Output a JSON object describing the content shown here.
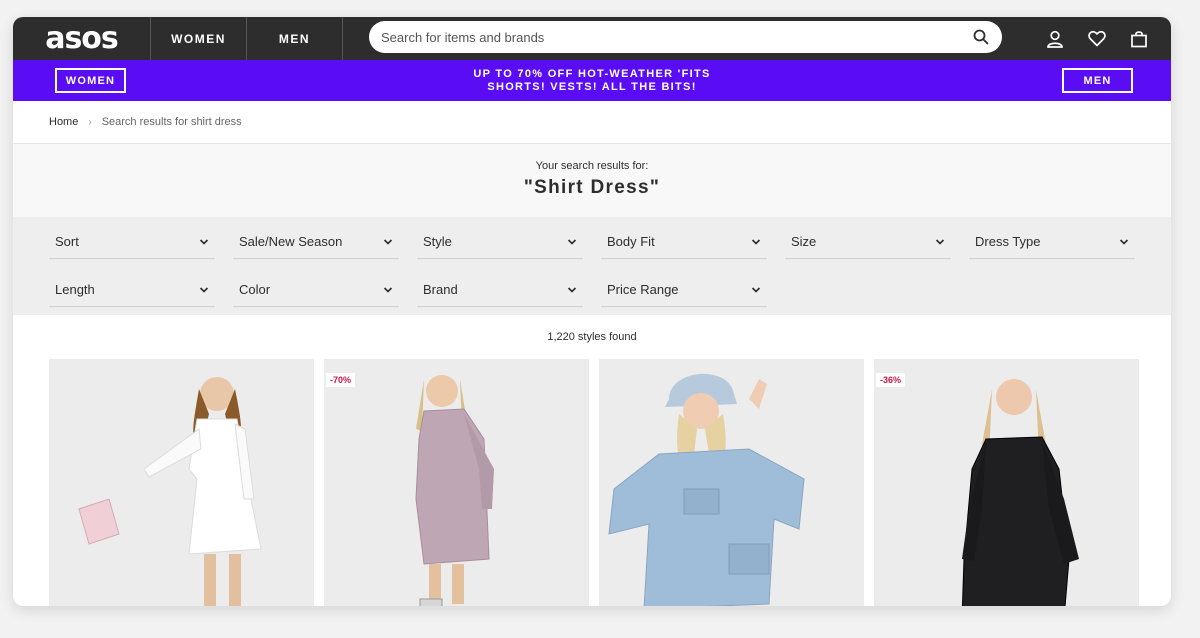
{
  "header": {
    "logo": "asos",
    "nav": [
      "WOMEN",
      "MEN"
    ],
    "search_placeholder": "Search for items and brands",
    "icons": [
      "search-icon",
      "account-icon",
      "heart-icon",
      "bag-icon"
    ]
  },
  "promo": {
    "left_button": "WOMEN",
    "right_button": "MEN",
    "line1": "UP TO 70% OFF HOT-WEATHER 'FITS",
    "line2": "SHORTS! VESTS! ALL THE BITS!",
    "color": "#5a0df5"
  },
  "breadcrumb": {
    "home": "Home",
    "separator": "›",
    "current": "Search results for shirt dress"
  },
  "results": {
    "subtitle": "Your search results for:",
    "query": "\"Shirt Dress\"",
    "count": "1,220 styles found"
  },
  "filters": {
    "row1": [
      "Sort",
      "Sale/New Season",
      "Style",
      "Body Fit",
      "Size",
      "Dress Type"
    ],
    "row2": [
      "Length",
      "Color",
      "Brand",
      "Price Range"
    ]
  },
  "products": [
    {
      "badge": "",
      "dress_color": "#ffffff"
    },
    {
      "badge": "-70%",
      "dress_color": "#bfa6b4"
    },
    {
      "badge": "",
      "dress_color": "#9fbcd9"
    },
    {
      "badge": "-36%",
      "dress_color": "#1f1f22"
    }
  ],
  "badge_color": "#d01345"
}
